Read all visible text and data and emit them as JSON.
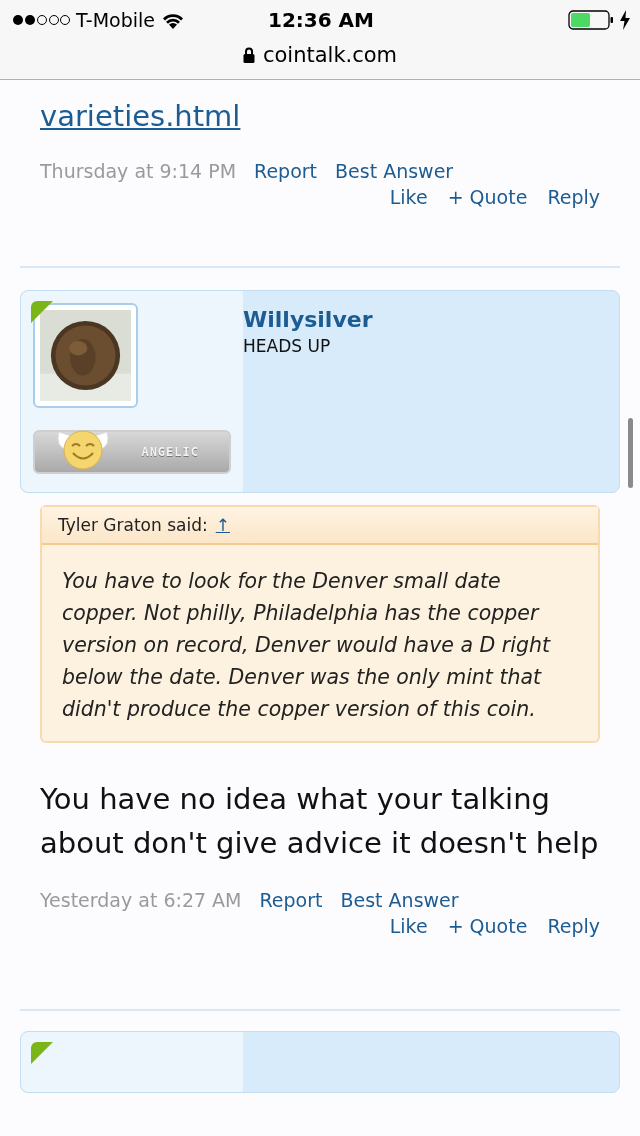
{
  "status_bar": {
    "carrier": "T-Mobile",
    "time": "12:36 AM"
  },
  "address_bar": {
    "url": "cointalk.com"
  },
  "posts": [
    {
      "kind": "tail",
      "link": "varieties.html",
      "date": "Thursday at 9:14 PM",
      "actions": [
        "Report",
        "Best Answer"
      ],
      "buttons": [
        "Like",
        "+ Quote",
        "Reply"
      ]
    },
    {
      "kind": "full",
      "author": {
        "name": "Willysilver",
        "title": "HEADS UP",
        "badge": "ANGELIC",
        "online": true
      },
      "quote": {
        "attribution": "Tyler Graton said:",
        "jump": "↑",
        "text": "You have to look for the Denver small date copper. Not philly, Philadelphia has the copper version on record, Denver would have a D right below the date. Denver was the only mint that didn't produce the copper version of this coin."
      },
      "message": "You have no idea what your talking about don't give advice it doesn't help",
      "date": "Yesterday at 6:27 AM",
      "actions": [
        "Report",
        "Best Answer"
      ],
      "buttons": [
        "Like",
        "+ Quote",
        "Reply"
      ]
    },
    {
      "kind": "partial",
      "author": {
        "online": true
      }
    }
  ]
}
